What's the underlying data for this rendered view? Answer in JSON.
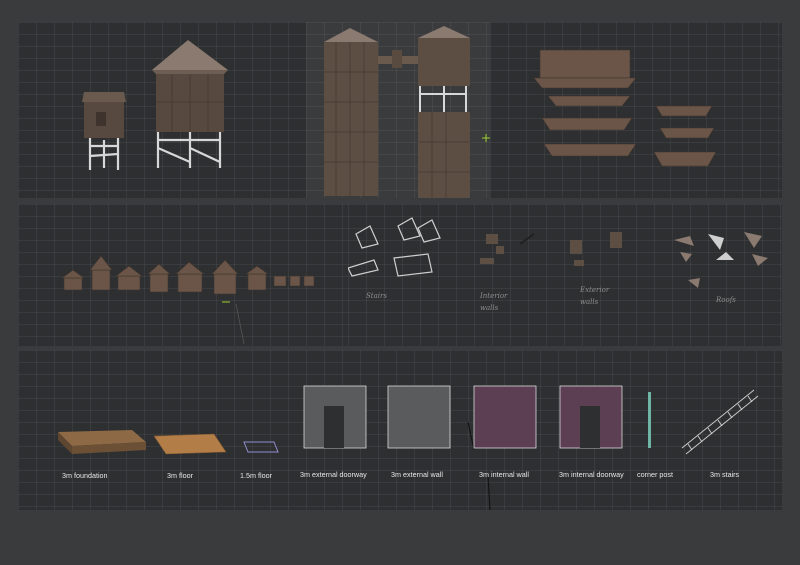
{
  "colors": {
    "sheet_bg": "#3a3b3d",
    "viewport_bg": "#2e2f31",
    "wood": "#5e4f45",
    "wood_light": "#8a7460",
    "frame": "#d8d8d8",
    "internal_wall": "#5c3f52",
    "foundation": "#7a5a3a",
    "floor": "#a37445"
  },
  "panel_sketch": {
    "labels": [
      {
        "key": "stairs",
        "text": "Stairs"
      },
      {
        "key": "internal",
        "text": "Interior walls"
      },
      {
        "key": "exterior",
        "text": "Exterior walls"
      },
      {
        "key": "roofs",
        "text": "Roofs"
      }
    ]
  },
  "panel_modules": {
    "labels": [
      {
        "key": "foundation",
        "text": "3m foundation",
        "icon": "foundation-slab"
      },
      {
        "key": "floor",
        "text": "3m floor",
        "icon": "floor-tile"
      },
      {
        "key": "floor_half",
        "text": "1.5m floor",
        "icon": "floor-tile-small"
      },
      {
        "key": "ext_doorway",
        "text": "3m external doorway",
        "icon": "doorway-wall"
      },
      {
        "key": "ext_wall",
        "text": "3m external wall",
        "icon": "wall-panel"
      },
      {
        "key": "int_wall",
        "text": "3m internal wall",
        "icon": "wall-panel"
      },
      {
        "key": "int_doorway",
        "text": "3m internal doorway",
        "icon": "doorway-wall"
      },
      {
        "key": "corner_post",
        "text": "corner post",
        "icon": "post"
      },
      {
        "key": "stairs",
        "text": "3m stairs",
        "icon": "stairs"
      }
    ]
  }
}
